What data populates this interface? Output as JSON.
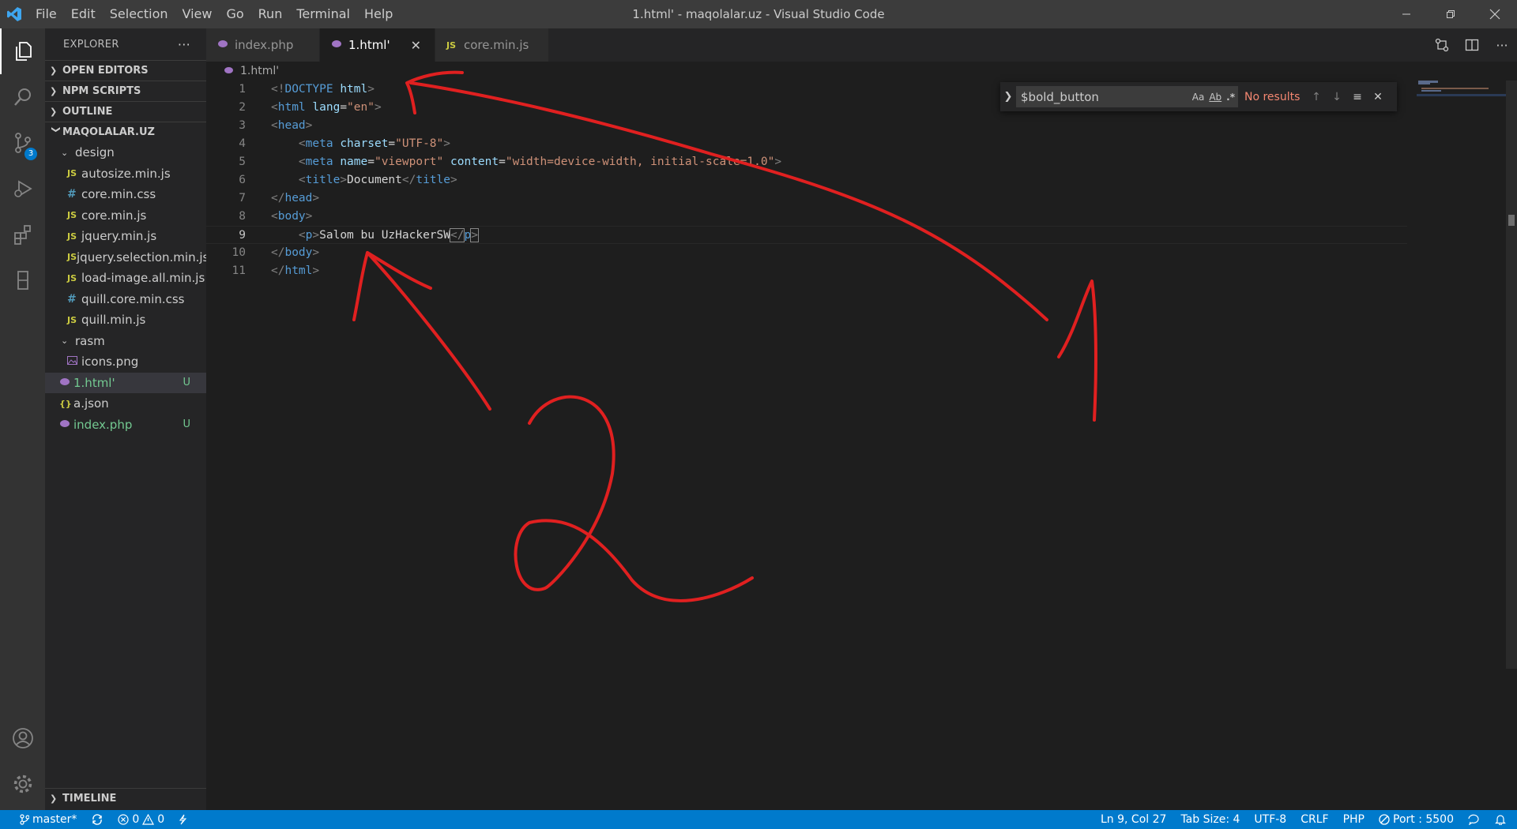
{
  "window": {
    "title": "1.html' - maqolalar.uz - Visual Studio Code",
    "menu": [
      "File",
      "Edit",
      "Selection",
      "View",
      "Go",
      "Run",
      "Terminal",
      "Help"
    ]
  },
  "activity": {
    "source_control_badge": "3"
  },
  "sidebar": {
    "title": "EXPLORER",
    "sections": {
      "open_editors": "OPEN EDITORS",
      "npm_scripts": "NPM SCRIPTS",
      "outline": "OUTLINE",
      "project": "MAQOLALAR.UZ",
      "timeline": "TIMELINE"
    },
    "folders": {
      "design": "design",
      "rasm": "rasm"
    },
    "design_files": [
      {
        "name": "autosize.min.js",
        "icon": "JS"
      },
      {
        "name": "core.min.css",
        "icon": "#"
      },
      {
        "name": "core.min.js",
        "icon": "JS"
      },
      {
        "name": "jquery.min.js",
        "icon": "JS"
      },
      {
        "name": "jquery.selection.min.js",
        "icon": "JS"
      },
      {
        "name": "load-image.all.min.js",
        "icon": "JS"
      },
      {
        "name": "quill.core.min.css",
        "icon": "#"
      },
      {
        "name": "quill.min.js",
        "icon": "JS"
      }
    ],
    "rasm_files": [
      {
        "name": "icons.png"
      }
    ],
    "root_files": [
      {
        "name": "1.html'",
        "status": "U"
      },
      {
        "name": "a.json",
        "icon": "{}"
      },
      {
        "name": "index.php",
        "status": "U"
      }
    ]
  },
  "tabs": [
    {
      "label": "index.php"
    },
    {
      "label": "1.html'"
    },
    {
      "label": "core.min.js",
      "icon": "JS"
    }
  ],
  "breadcrumb": "1.html'",
  "editor": {
    "line_numbers": [
      "1",
      "2",
      "3",
      "4",
      "5",
      "6",
      "7",
      "8",
      "9",
      "10",
      "11"
    ],
    "l1": {
      "a": "<!",
      "b": "DOCTYPE",
      "c": "html",
      "d": ">"
    },
    "l2": {
      "a": "<",
      "b": "html",
      "c": "lang",
      "d": "=",
      "e": "\"en\"",
      "f": ">"
    },
    "l3": {
      "a": "<",
      "b": "head",
      "c": ">"
    },
    "l4": {
      "a": "<",
      "b": "meta",
      "c": "charset",
      "d": "=",
      "e": "\"UTF-8\"",
      "f": ">"
    },
    "l5": {
      "a": "<",
      "b": "meta",
      "c": "name",
      "d": "=",
      "e": "\"viewport\"",
      "f": "content",
      "g": "=",
      "h": "\"width=device-width, initial-scale=1.0\"",
      "i": ">"
    },
    "l6": {
      "a": "<",
      "b": "title",
      "c": ">",
      "d": "Document",
      "e": "</",
      "f": "title",
      "g": ">"
    },
    "l7": {
      "a": "</",
      "b": "head",
      "c": ">"
    },
    "l8": {
      "a": "<",
      "b": "body",
      "c": ">"
    },
    "l9": {
      "a": "<",
      "b": "p",
      "c": ">",
      "d": "Salom bu UzHackerSW",
      "e": "</",
      "f": "p",
      "g": ">"
    },
    "l10": {
      "a": "</",
      "b": "body",
      "c": ">"
    },
    "l11": {
      "a": "</",
      "b": "html",
      "c": ">"
    }
  },
  "find": {
    "query": "$bold_button",
    "match_case": "Aa",
    "whole_word": "Ab",
    "regex": ".*",
    "result": "No results"
  },
  "status": {
    "branch": "master*",
    "errors": "0",
    "warnings": "0",
    "position": "Ln 9, Col 27",
    "tab_size": "Tab Size: 4",
    "encoding": "UTF-8",
    "eol": "CRLF",
    "language": "PHP",
    "port": "Port : 5500"
  },
  "colors": {
    "accent": "#007acc",
    "annotation": "#e02020",
    "git_untracked": "#73c991"
  }
}
